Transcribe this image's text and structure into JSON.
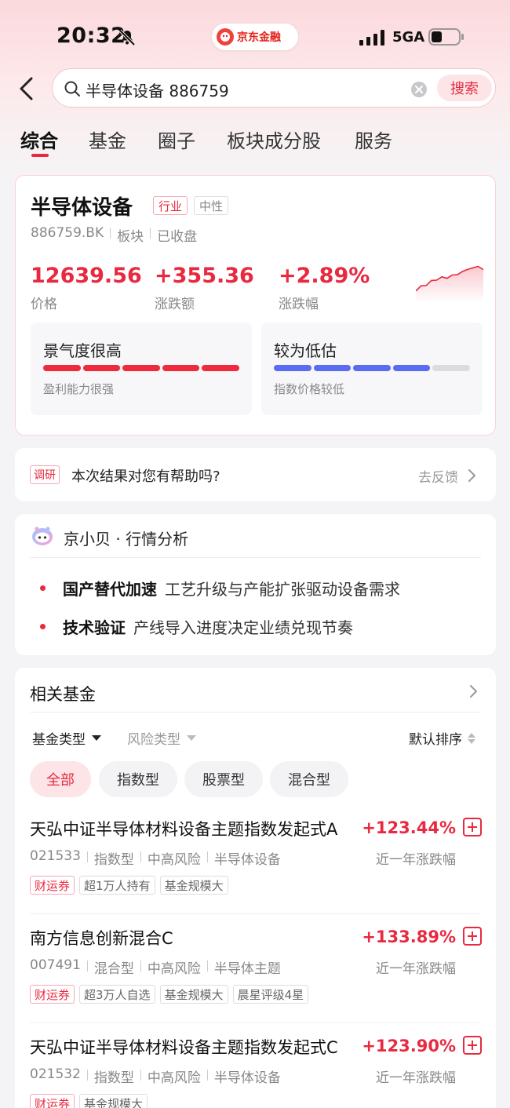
{
  "status": {
    "time": "20:32",
    "network": "5GA",
    "brand": "京东金融"
  },
  "search": {
    "query": "半导体设备 886759",
    "button": "搜索"
  },
  "tabs": [
    {
      "label": "综合",
      "active": true
    },
    {
      "label": "基金",
      "active": false
    },
    {
      "label": "圈子",
      "active": false
    },
    {
      "label": "板块成分股",
      "active": false
    },
    {
      "label": "服务",
      "active": false
    }
  ],
  "stock": {
    "name": "半导体设备",
    "tag_industry": "行业",
    "tag_sentiment": "中性",
    "code": "886759.BK",
    "category": "板块",
    "market_status": "已收盘",
    "price": "12639.56",
    "price_label": "价格",
    "change": "+355.36",
    "change_label": "涨跌额",
    "change_pct": "+2.89%",
    "change_pct_label": "涨跌幅",
    "sparkline_trend": [
      0.2,
      0.45,
      0.35,
      0.6,
      0.5,
      0.7,
      0.55,
      0.75,
      0.65,
      0.85,
      0.8,
      0.95,
      0.88,
      0.9
    ],
    "metrics": [
      {
        "title": "景气度很高",
        "subtitle": "盈利能力很强",
        "level_segments": 5,
        "total_segments": 5,
        "color": "#ee2a3c"
      },
      {
        "title": "较为低估",
        "subtitle": "指数价格较低",
        "level_segments": 4,
        "total_segments": 5,
        "color": "#5b6cf0"
      }
    ]
  },
  "feedback": {
    "tag": "调研",
    "question": "本次结果对您有帮助吗?",
    "link": "去反馈"
  },
  "analysis": {
    "title": "京小贝 · 行情分析",
    "points": [
      {
        "strong": "国产替代加速",
        "text": "工艺升级与产能扩张驱动设备需求"
      },
      {
        "strong": "技术验证",
        "text": "产线导入进度决定业绩兑现节奏"
      }
    ]
  },
  "funds": {
    "title": "相关基金",
    "filter_fund_type": "基金类型",
    "filter_risk_type": "风险类型",
    "sort": "默认排序",
    "chips": [
      {
        "label": "全部",
        "active": true
      },
      {
        "label": "指数型",
        "active": false
      },
      {
        "label": "股票型",
        "active": false
      },
      {
        "label": "混合型",
        "active": false
      }
    ],
    "items": [
      {
        "name": "天弘中证半导体材料设备主题指数发起式A",
        "return": "+123.44%",
        "period": "近一年涨跌幅",
        "code": "021533",
        "type": "指数型",
        "risk": "中高风险",
        "theme": "半导体设备",
        "tags": [
          "财运券",
          "超1万人持有",
          "基金规模大"
        ]
      },
      {
        "name": "南方信息创新混合C",
        "return": "+133.89%",
        "period": "近一年涨跌幅",
        "code": "007491",
        "type": "混合型",
        "risk": "中高风险",
        "theme": "半导体主题",
        "tags": [
          "财运券",
          "超3万人自选",
          "基金规模大",
          "晨星评级4星"
        ]
      },
      {
        "name": "天弘中证半导体材料设备主题指数发起式C",
        "return": "+123.90%",
        "period": "近一年涨跌幅",
        "code": "021532",
        "type": "指数型",
        "risk": "中高风险",
        "theme": "半导体设备",
        "tags": [
          "财运券",
          "基金规模大"
        ]
      }
    ]
  }
}
